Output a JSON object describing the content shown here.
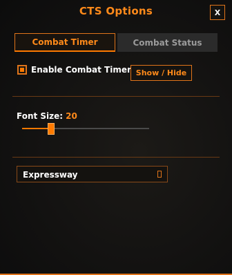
{
  "window": {
    "title": "CTS Options",
    "close_label": "X"
  },
  "tabs": [
    {
      "label": "Combat Timer",
      "active": true
    },
    {
      "label": "Combat Status",
      "active": false
    }
  ],
  "combat_timer": {
    "enable_checkbox": {
      "label": "Enable Combat Timer",
      "checked": true
    },
    "show_hide_button": "Show / Hide",
    "font_size": {
      "label": "Font Size:",
      "value": "20",
      "slider_fraction": 0.23
    },
    "font_dropdown": {
      "selected": "Expressway"
    }
  },
  "colors": {
    "accent": "#ff7a00",
    "accent_text": "#ff8a1a",
    "border": "#e0741a",
    "inactive_tab": "#2b2b2b"
  }
}
